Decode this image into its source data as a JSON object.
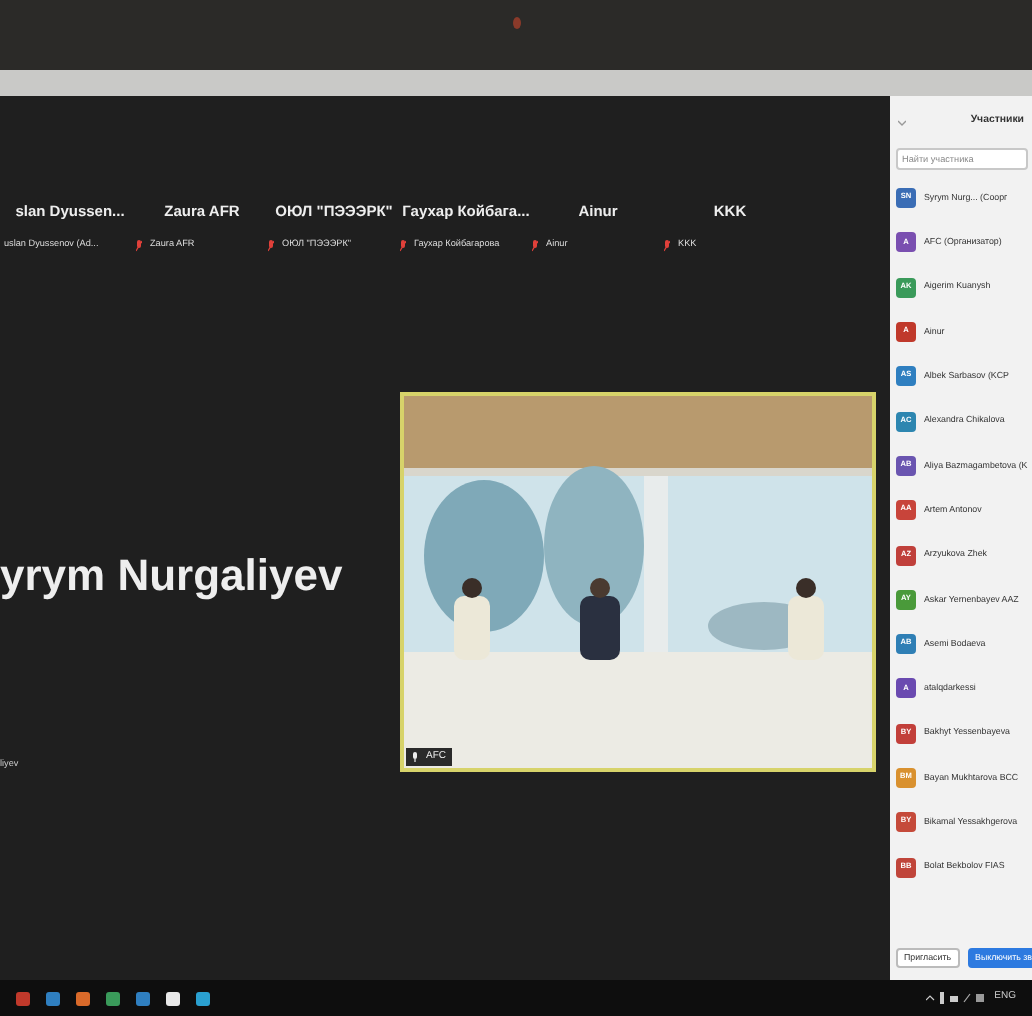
{
  "meeting": {
    "tiles": [
      {
        "name": "slan Dyussen...",
        "caption": "uslan Dyussenov (Ad...",
        "muted": false
      },
      {
        "name": "Zaura AFR",
        "caption": "Zaura AFR",
        "muted": true
      },
      {
        "name": "ОЮЛ \"ПЭЭЭРК\"",
        "caption": "ОЮЛ \"ПЭЭЭРК\"",
        "muted": true
      },
      {
        "name": "Гаухар Койбага...",
        "caption": "Гаухар Койбагарова",
        "muted": true
      },
      {
        "name": "Ainur",
        "caption": "Ainur",
        "muted": true
      },
      {
        "name": "KKK",
        "caption": "KKK",
        "muted": true
      }
    ],
    "speaker": {
      "name": "yrym Nurgaliyev",
      "caption": "liyev"
    },
    "video": {
      "label": "AFC"
    }
  },
  "participants_panel": {
    "title": "Участники",
    "search": {
      "placeholder": "Найти участника"
    },
    "participants": [
      {
        "initials": "SN",
        "name": "Syrym Nurg... (Соорг",
        "color": "#3a6db5"
      },
      {
        "initials": "A",
        "name": "AFC (Организатор)",
        "color": "#7a4fb0"
      },
      {
        "initials": "AK",
        "name": "Aigerim Kuanysh",
        "color": "#3a9a5a"
      },
      {
        "initials": "A",
        "name": "Ainur",
        "color": "#c0392b"
      },
      {
        "initials": "AS",
        "name": "Albek Sarbasov (KCP",
        "color": "#2f7fc0"
      },
      {
        "initials": "AC",
        "name": "Alexandra Chikalova",
        "color": "#2d86b0"
      },
      {
        "initials": "AB",
        "name": "Aliya Bazmagambetova (K",
        "color": "#6a55b0"
      },
      {
        "initials": "AA",
        "name": "Artem Antonov",
        "color": "#c8443a"
      },
      {
        "initials": "AZ",
        "name": "Arzyukova Zhek",
        "color": "#c0403b"
      },
      {
        "initials": "AY",
        "name": "Askar Yernenbayev AAZ",
        "color": "#4a9a3a"
      },
      {
        "initials": "AB",
        "name": "Asemi Bodaeva",
        "color": "#2f7fb5"
      },
      {
        "initials": "A",
        "name": "atalqdarkessi",
        "color": "#6a4ab0"
      },
      {
        "initials": "BY",
        "name": "Bakhyt Yessenbayeva",
        "color": "#c23f3a"
      },
      {
        "initials": "BM",
        "name": "Bayan Mukhtarova BCC",
        "color": "#d9912f"
      },
      {
        "initials": "BY",
        "name": "Bikamal Yessakhgerova",
        "color": "#c54a3a"
      },
      {
        "initials": "BB",
        "name": "Bolat Bekbolov FIAS",
        "color": "#c0453a"
      }
    ],
    "buttons": [
      {
        "label": "Пригласить",
        "primary": false
      },
      {
        "label": "Выключить зв",
        "primary": true
      }
    ]
  },
  "taskbar": {
    "language": "ENG"
  }
}
